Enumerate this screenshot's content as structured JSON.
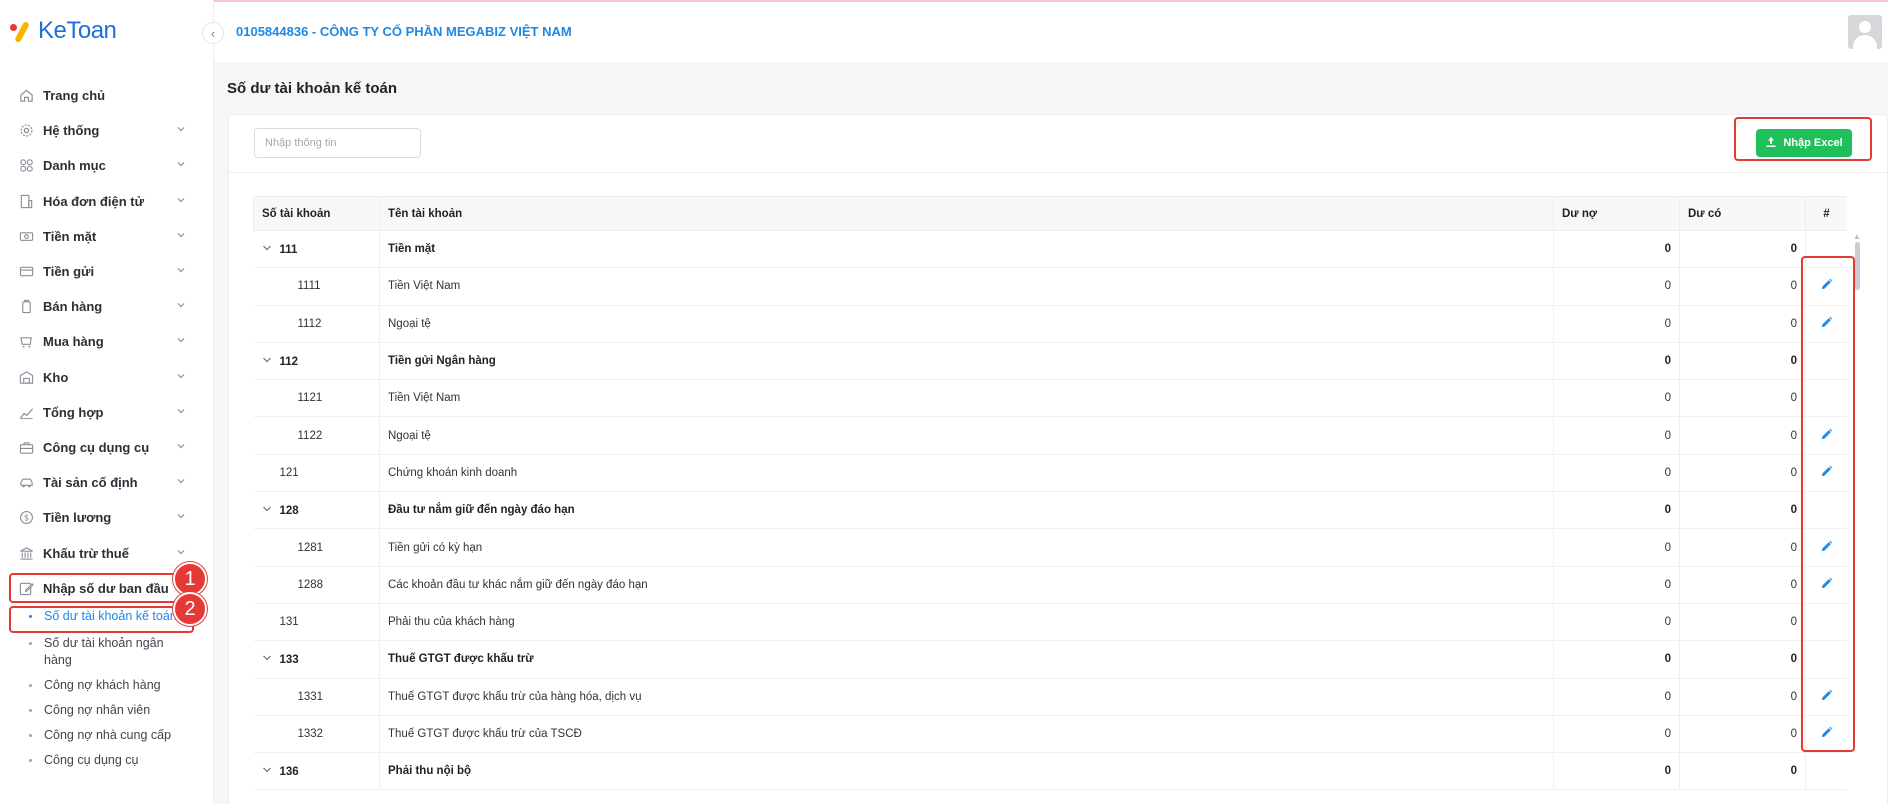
{
  "app": {
    "logo_text": "KeToan"
  },
  "header": {
    "company": "0105844836 - CÔNG TY CỔ PHẦN MEGABIZ VIỆT NAM"
  },
  "page": {
    "title": "Số dư tài khoản kế toán"
  },
  "sidebar": {
    "items": [
      {
        "label": "Trang chủ",
        "icon": "home-icon",
        "expandable": false
      },
      {
        "label": "Hệ thống",
        "icon": "gear-icon",
        "expandable": true
      },
      {
        "label": "Danh mục",
        "icon": "grid-icon",
        "expandable": true
      },
      {
        "label": "Hóa đơn điện tử",
        "icon": "invoice-icon",
        "expandable": true
      },
      {
        "label": "Tiền mặt",
        "icon": "cash-icon",
        "expandable": true
      },
      {
        "label": "Tiền gửi",
        "icon": "card-icon",
        "expandable": true
      },
      {
        "label": "Bán hàng",
        "icon": "sale-icon",
        "expandable": true
      },
      {
        "label": "Mua hàng",
        "icon": "cart-icon",
        "expandable": true
      },
      {
        "label": "Kho",
        "icon": "warehouse-icon",
        "expandable": true
      },
      {
        "label": "Tổng hợp",
        "icon": "chart-icon",
        "expandable": true
      },
      {
        "label": "Công cụ dụng cụ",
        "icon": "toolbox-icon",
        "expandable": true
      },
      {
        "label": "Tài sản cố định",
        "icon": "car-icon",
        "expandable": true
      },
      {
        "label": "Tiền lương",
        "icon": "dollar-icon",
        "expandable": true
      },
      {
        "label": "Khấu trừ thuế",
        "icon": "bank-icon",
        "expandable": true
      },
      {
        "label": "Nhập số dư ban đầu",
        "icon": "edit-note-icon",
        "expandable": false
      }
    ],
    "submenu": [
      {
        "label": "Số dư tài khoản kế toán",
        "active": true
      },
      {
        "label": "Số dư tài khoản ngân hàng",
        "active": false
      },
      {
        "label": "Công nợ khách hàng",
        "active": false
      },
      {
        "label": "Công nợ nhân viên",
        "active": false
      },
      {
        "label": "Công nợ nhà cung cấp",
        "active": false
      },
      {
        "label": "Công cụ dụng cụ",
        "active": false
      }
    ],
    "annotations": [
      "1",
      "2"
    ]
  },
  "toolbar": {
    "search_placeholder": "Nhập thông tin",
    "import_excel_label": "Nhập Excel"
  },
  "table": {
    "columns": [
      "Số tài khoản",
      "Tên tài khoản",
      "Dư nợ",
      "Dư có",
      "#"
    ],
    "rows": [
      {
        "code": "111",
        "name": "Tiền mặt",
        "debit": "0",
        "credit": "0",
        "type": "parent",
        "edit": false
      },
      {
        "code": "1111",
        "name": "Tiền Việt Nam",
        "debit": "0",
        "credit": "0",
        "type": "child",
        "edit": true
      },
      {
        "code": "1112",
        "name": "Ngoại tệ",
        "debit": "0",
        "credit": "0",
        "type": "child",
        "edit": true
      },
      {
        "code": "112",
        "name": "Tiền gửi Ngân hàng",
        "debit": "0",
        "credit": "0",
        "type": "parent",
        "edit": false
      },
      {
        "code": "1121",
        "name": "Tiền Việt Nam",
        "debit": "0",
        "credit": "0",
        "type": "child",
        "edit": false
      },
      {
        "code": "1122",
        "name": "Ngoại tệ",
        "debit": "0",
        "credit": "0",
        "type": "child",
        "edit": true
      },
      {
        "code": "121",
        "name": "Chứng khoán kinh doanh",
        "debit": "0",
        "credit": "0",
        "type": "single",
        "edit": true
      },
      {
        "code": "128",
        "name": "Đầu tư nắm giữ đến ngày đáo hạn",
        "debit": "0",
        "credit": "0",
        "type": "parent",
        "edit": false
      },
      {
        "code": "1281",
        "name": "Tiền gửi có kỳ hạn",
        "debit": "0",
        "credit": "0",
        "type": "child",
        "edit": true
      },
      {
        "code": "1288",
        "name": "Các khoản đầu tư khác nắm giữ đến ngày đáo hạn",
        "debit": "0",
        "credit": "0",
        "type": "child",
        "edit": true
      },
      {
        "code": "131",
        "name": "Phải thu của khách hàng",
        "debit": "0",
        "credit": "0",
        "type": "single",
        "edit": false
      },
      {
        "code": "133",
        "name": "Thuế GTGT được khấu trừ",
        "debit": "0",
        "credit": "0",
        "type": "parent",
        "edit": false
      },
      {
        "code": "1331",
        "name": "Thuế GTGT được khấu trừ của hàng hóa, dịch vụ",
        "debit": "0",
        "credit": "0",
        "type": "child",
        "edit": true
      },
      {
        "code": "1332",
        "name": "Thuế GTGT được khấu trừ của TSCĐ",
        "debit": "0",
        "credit": "0",
        "type": "child",
        "edit": true
      },
      {
        "code": "136",
        "name": "Phải thu nội bộ",
        "debit": "0",
        "credit": "0",
        "type": "parent",
        "edit": false
      }
    ]
  }
}
